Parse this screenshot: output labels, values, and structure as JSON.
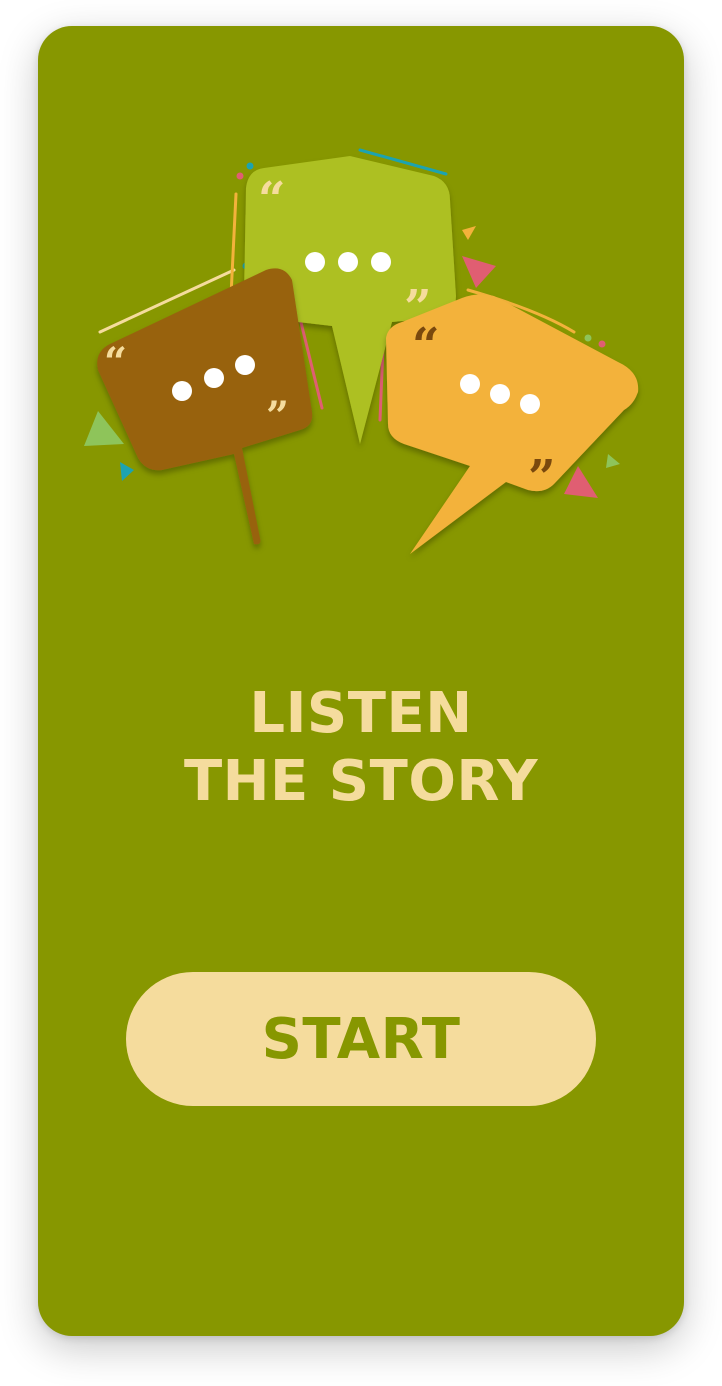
{
  "headline": {
    "line1": "LISTEN",
    "line2": "THE STORY"
  },
  "start_button": {
    "label": "START"
  },
  "colors": {
    "background": "#879700",
    "accent_cream": "#f5dc9d",
    "bubble_brown": "#98620b",
    "bubble_lime": "#adc021",
    "bubble_orange": "#f3b23b",
    "confetti_pink": "#e05e72",
    "confetti_teal": "#1ca3b0",
    "confetti_lightgreen": "#8ec45a"
  },
  "illustration": {
    "icon": "speech-bubbles-illustration"
  }
}
